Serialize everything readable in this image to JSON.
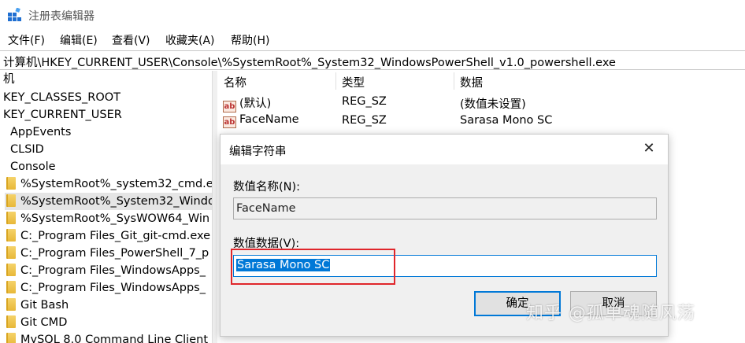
{
  "window": {
    "title": "注册表编辑器"
  },
  "menu": [
    "文件(F)",
    "编辑(E)",
    "查看(V)",
    "收藏夹(A)",
    "帮助(H)"
  ],
  "address": "计算机\\HKEY_CURRENT_USER\\Console\\%SystemRoot%_System32_WindowsPowerShell_v1.0_powershell.exe",
  "tree": {
    "root": "机",
    "items": [
      "KEY_CLASSES_ROOT",
      "KEY_CURRENT_USER",
      "AppEvents",
      "CLSID",
      "Console",
      "%SystemRoot%_system32_cmd.e",
      "%SystemRoot%_System32_Windo",
      "%SystemRoot%_SysWOW64_Win",
      "C:_Program Files_Git_git-cmd.exe",
      "C:_Program Files_PowerShell_7_p",
      "C:_Program Files_WindowsApps_",
      "C:_Program Files_WindowsApps_",
      "Git Bash",
      "Git CMD",
      "MySQL 8.0 Command Line Client"
    ]
  },
  "list": {
    "columns": [
      "名称",
      "类型",
      "数据"
    ],
    "rows": [
      {
        "icon": "ab",
        "name": "(默认)",
        "type": "REG_SZ",
        "data": "(数值未设置)"
      },
      {
        "icon": "ab",
        "name": "FaceName",
        "type": "REG_SZ",
        "data": "Sarasa Mono SC"
      }
    ]
  },
  "dialog": {
    "title": "编辑字符串",
    "name_label": "数值名称(N):",
    "name_value": "FaceName",
    "data_label": "数值数据(V):",
    "data_value": "Sarasa Mono SC",
    "ok_label": "确定",
    "cancel_label": "取消"
  },
  "watermark": "知乎 @孤单魂随风荡",
  "colors": {
    "selection": "#0078d7",
    "highlight_box": "#e0262b",
    "dialog_bg": "#f0f0f0"
  }
}
